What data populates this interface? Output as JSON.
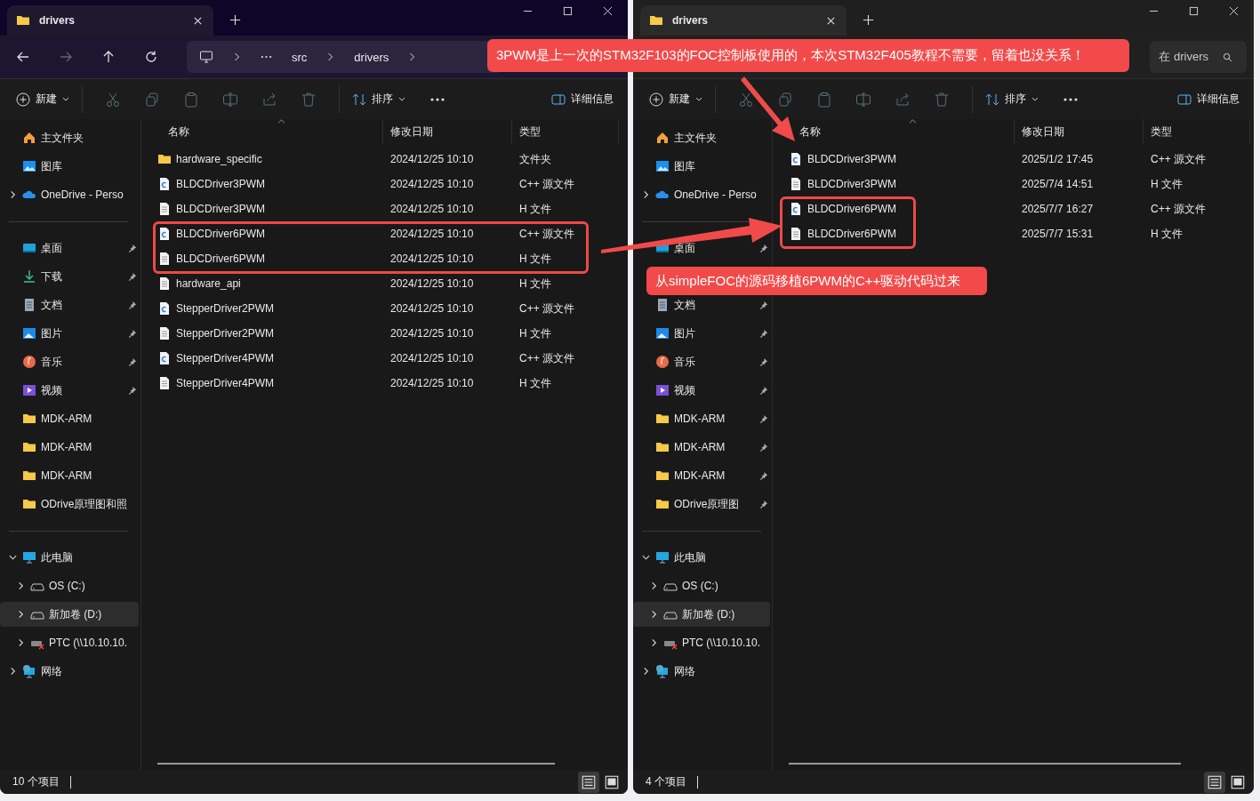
{
  "windows": [
    {
      "active": true,
      "tab": "drivers",
      "address": {
        "crumbs": [
          "src",
          "drivers"
        ]
      },
      "toolbar": {
        "new": "新建",
        "sort": "排序",
        "details": "详细信息"
      },
      "sidebar": [
        {
          "items": [
            {
              "label": "主文件夹",
              "kind": "home",
              "selected": false
            },
            {
              "label": "图库",
              "kind": "gallery",
              "selected": false
            },
            {
              "label": "OneDrive - Perso",
              "kind": "cloud",
              "expanded": false,
              "selected": false
            }
          ]
        },
        {
          "items": [
            {
              "label": "桌面",
              "kind": "desktop",
              "pinned": true,
              "selected": false
            },
            {
              "label": "下载",
              "kind": "download",
              "pinned": true,
              "selected": false
            },
            {
              "label": "文档",
              "kind": "document",
              "pinned": true,
              "selected": false
            },
            {
              "label": "图片",
              "kind": "picture",
              "pinned": true,
              "selected": false
            },
            {
              "label": "音乐",
              "kind": "music",
              "pinned": true,
              "selected": false
            },
            {
              "label": "视频",
              "kind": "video",
              "pinned": true,
              "selected": false
            },
            {
              "label": "MDK-ARM",
              "kind": "folder",
              "pinned": false,
              "selected": false
            },
            {
              "label": "MDK-ARM",
              "kind": "folder",
              "pinned": false,
              "selected": false
            },
            {
              "label": "MDK-ARM",
              "kind": "folder",
              "pinned": false,
              "selected": false
            },
            {
              "label": "ODrive原理图和照",
              "kind": "folder",
              "pinned": false,
              "selected": false
            }
          ]
        },
        {
          "items": [
            {
              "label": "此电脑",
              "kind": "pc",
              "expanded": true,
              "selected": false,
              "children": [
                {
                  "label": "OS (C:)",
                  "kind": "drive",
                  "expanded": false,
                  "selected": false
                },
                {
                  "label": "新加卷 (D:)",
                  "kind": "drive",
                  "expanded": false,
                  "selected": true
                },
                {
                  "label": "PTC (\\\\10.10.10.",
                  "kind": "netdrive",
                  "expanded": false,
                  "selected": false
                }
              ]
            },
            {
              "label": "网络",
              "kind": "network",
              "expanded": false,
              "selected": false
            }
          ]
        }
      ],
      "columns": [
        "名称",
        "修改日期",
        "类型"
      ],
      "rows": [
        {
          "name": "hardware_specific",
          "date": "2024/12/25 10:10",
          "type": "文件夹",
          "kind": "folder"
        },
        {
          "name": "BLDCDriver3PWM",
          "date": "2024/12/25 10:10",
          "type": "C++ 源文件",
          "kind": "cpp"
        },
        {
          "name": "BLDCDriver3PWM",
          "date": "2024/12/25 10:10",
          "type": "H 文件",
          "kind": "h"
        },
        {
          "name": "BLDCDriver6PWM",
          "date": "2024/12/25 10:10",
          "type": "C++ 源文件",
          "kind": "cpp"
        },
        {
          "name": "BLDCDriver6PWM",
          "date": "2024/12/25 10:10",
          "type": "H 文件",
          "kind": "h"
        },
        {
          "name": "hardware_api",
          "date": "2024/12/25 10:10",
          "type": "H 文件",
          "kind": "h"
        },
        {
          "name": "StepperDriver2PWM",
          "date": "2024/12/25 10:10",
          "type": "C++ 源文件",
          "kind": "cpp"
        },
        {
          "name": "StepperDriver2PWM",
          "date": "2024/12/25 10:10",
          "type": "H 文件",
          "kind": "h"
        },
        {
          "name": "StepperDriver4PWM",
          "date": "2024/12/25 10:10",
          "type": "C++ 源文件",
          "kind": "cpp"
        },
        {
          "name": "StepperDriver4PWM",
          "date": "2024/12/25 10:10",
          "type": "H 文件",
          "kind": "h"
        }
      ],
      "status": "10 个项目"
    },
    {
      "active": false,
      "tab": "drivers",
      "search": {
        "placeholder": "在 drivers"
      },
      "toolbar": {
        "new": "新建",
        "sort": "排序",
        "details": "详细信息"
      },
      "sidebar": [
        {
          "items": [
            {
              "label": "主文件夹",
              "kind": "home",
              "selected": false
            },
            {
              "label": "图库",
              "kind": "gallery",
              "selected": false
            },
            {
              "label": "OneDrive - Perso",
              "kind": "cloud",
              "expanded": false,
              "selected": false
            }
          ]
        },
        {
          "items": [
            {
              "label": "桌面",
              "kind": "desktop",
              "pinned": true,
              "selected": false
            },
            {
              "label": "文档",
              "kind": "document",
              "pinned": true,
              "selected": false,
              "gap": true
            },
            {
              "label": "图片",
              "kind": "picture",
              "pinned": true,
              "selected": false
            },
            {
              "label": "音乐",
              "kind": "music",
              "pinned": true,
              "selected": false
            },
            {
              "label": "视频",
              "kind": "video",
              "pinned": true,
              "selected": false
            },
            {
              "label": "MDK-ARM",
              "kind": "folder",
              "pinned": true,
              "selected": false
            },
            {
              "label": "MDK-ARM",
              "kind": "folder",
              "pinned": true,
              "selected": false
            },
            {
              "label": "MDK-ARM",
              "kind": "folder",
              "pinned": true,
              "selected": false
            },
            {
              "label": "ODrive原理图",
              "kind": "folder",
              "pinned": true,
              "selected": false
            }
          ]
        },
        {
          "items": [
            {
              "label": "此电脑",
              "kind": "pc",
              "expanded": true,
              "selected": false,
              "children": [
                {
                  "label": "OS (C:)",
                  "kind": "drive",
                  "expanded": false,
                  "selected": false
                },
                {
                  "label": "新加卷 (D:)",
                  "kind": "drive",
                  "expanded": false,
                  "selected": true
                },
                {
                  "label": "PTC (\\\\10.10.10.",
                  "kind": "netdrive",
                  "expanded": false,
                  "selected": false
                }
              ]
            },
            {
              "label": "网络",
              "kind": "network",
              "expanded": false,
              "selected": false
            }
          ]
        }
      ],
      "columns": [
        "名称",
        "修改日期",
        "类型"
      ],
      "rows": [
        {
          "name": "BLDCDriver3PWM",
          "date": "2025/1/2 17:45",
          "type": "C++ 源文件",
          "kind": "cpp"
        },
        {
          "name": "BLDCDriver3PWM",
          "date": "2025/7/4 14:51",
          "type": "H 文件",
          "kind": "h"
        },
        {
          "name": "BLDCDriver6PWM",
          "date": "2025/7/7 16:27",
          "type": "C++ 源文件",
          "kind": "cpp"
        },
        {
          "name": "BLDCDriver6PWM",
          "date": "2025/7/7 15:31",
          "type": "H 文件",
          "kind": "h"
        }
      ],
      "status": "4 个项目"
    }
  ],
  "callouts": [
    {
      "text": "3PWM是上一次的STM32F103的FOC控制板使用的，本次STM32F405教程不需要，留着也没关系！"
    },
    {
      "text": "从simpleFOC的源码移植6PWM的C++驱动代码过来"
    }
  ]
}
